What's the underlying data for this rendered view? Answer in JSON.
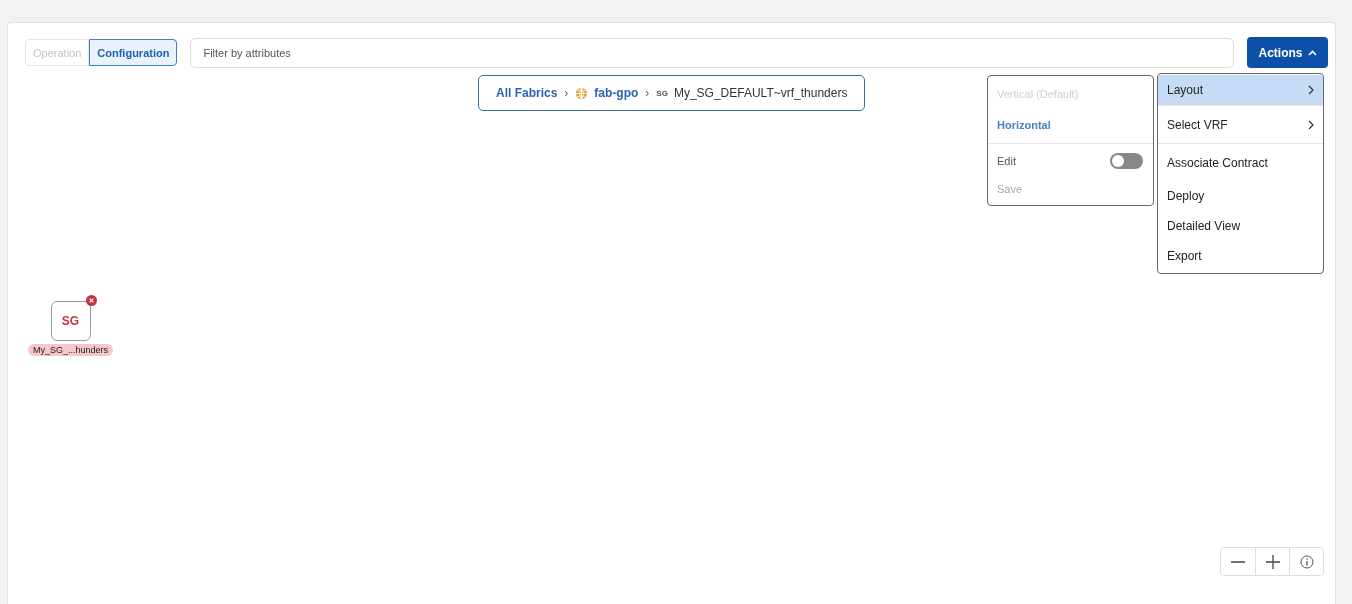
{
  "view_toggle": [
    {
      "label": "Operation",
      "selected": false
    },
    {
      "label": "Configuration",
      "selected": true
    }
  ],
  "filter": {
    "placeholder": "Filter by attributes"
  },
  "actions_button": {
    "label": "Actions",
    "expanded": true
  },
  "breadcrumb": {
    "separator": "›",
    "items": [
      {
        "kind": "link",
        "label": "All Fabrics"
      },
      {
        "kind": "fabric",
        "label": "fab-gpo"
      },
      {
        "kind": "group",
        "badge": "SG",
        "label": "My_SG_DEFAULT~vrf_thunders"
      }
    ]
  },
  "layout_submenu": {
    "options": [
      {
        "label": "Vertical (Default)",
        "selected": false
      },
      {
        "label": "Horizontal",
        "selected": true
      }
    ],
    "edit": {
      "label": "Edit",
      "on": false
    },
    "save": {
      "label": "Save",
      "disabled": true
    }
  },
  "actions_menu": [
    {
      "label": "Layout",
      "submenu": true,
      "selected": true
    },
    {
      "label": "Select VRF",
      "submenu": true,
      "selected": false
    },
    {
      "label": "Associate Contract",
      "submenu": false,
      "selected": false
    },
    {
      "label": "Deploy",
      "submenu": false,
      "selected": false
    },
    {
      "label": "Detailed View",
      "submenu": false,
      "selected": false
    },
    {
      "label": "Export",
      "submenu": false,
      "selected": false
    }
  ],
  "node": {
    "badge": "SG",
    "label": "My_SG_...hunders",
    "error": true
  }
}
